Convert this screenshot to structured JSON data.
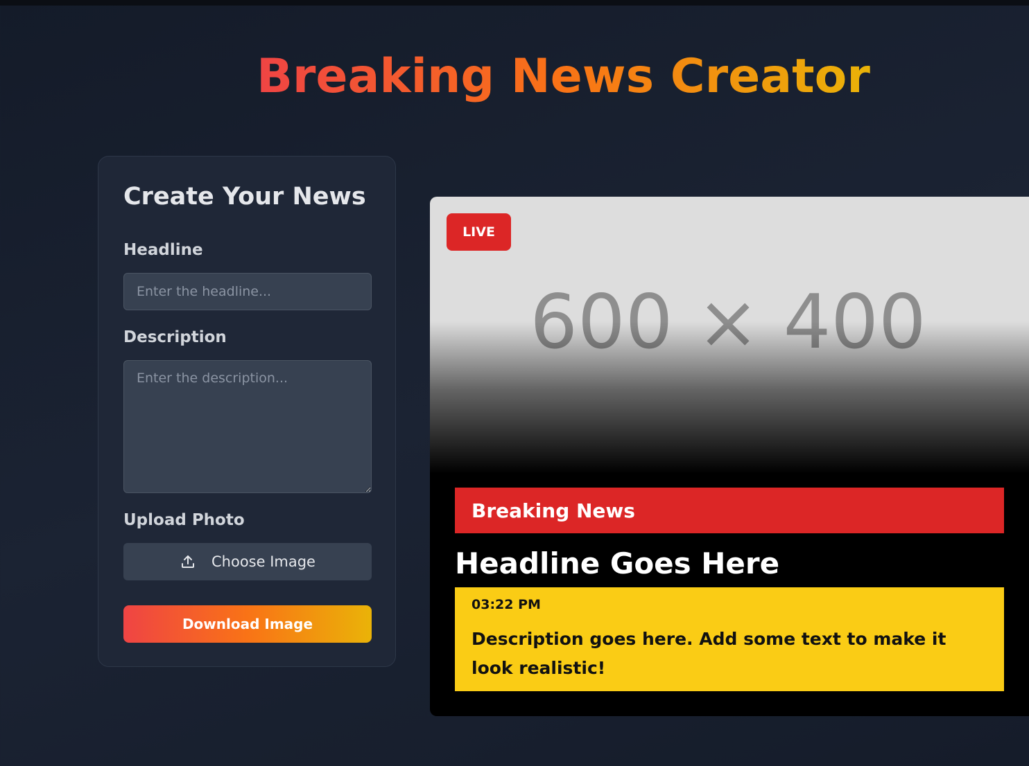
{
  "app": {
    "title": "Breaking News Creator"
  },
  "form": {
    "title": "Create Your News",
    "headline_label": "Headline",
    "headline_placeholder": "Enter the headline...",
    "headline_value": "",
    "description_label": "Description",
    "description_placeholder": "Enter the description...",
    "description_value": "",
    "upload_label": "Upload Photo",
    "upload_icon": "upload-icon",
    "upload_button": "Choose Image",
    "download_button": "Download Image"
  },
  "preview": {
    "placeholder_text": "600 × 400",
    "live_badge": "LIVE",
    "breaking_label": "Breaking News",
    "headline": "Headline Goes Here",
    "timestamp": "03:22 PM",
    "description": "Description goes here. Add some text to make it look realistic!"
  },
  "colors": {
    "background": "#1b2333",
    "panel": "#1f2737",
    "input": "#374151",
    "accent_red": "#dc2626",
    "accent_yellow": "#facc15",
    "gradient_start": "#ef4444",
    "gradient_end": "#eab308"
  }
}
